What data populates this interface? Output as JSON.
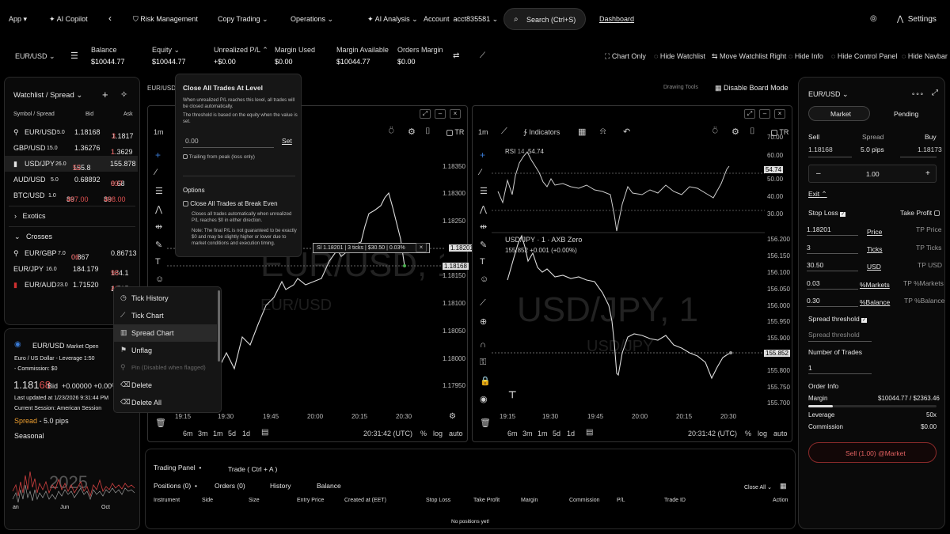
{
  "topnav": {
    "app": "App",
    "ai_copilot": "AI Copilot",
    "back": "‹",
    "risk_management": "Risk Management",
    "copy_trading": "Copy Trading",
    "operations": "Operations",
    "ai_analysis": "AI Analysis",
    "account_label": "Account",
    "account_id": "acct835581",
    "search": "Search (Ctrl+S)",
    "dashboard": "Dashboard",
    "settings": "Settings"
  },
  "account_bar": {
    "symbol": "EUR/USD",
    "balance_label": "Balance",
    "balance": "$10044.77",
    "equity_label": "Equity",
    "equity": "$10044.77",
    "upl_label": "Unrealized P/L",
    "upl": "+$0.00",
    "margin_used_label": "Margin Used",
    "margin_used": "$0.00",
    "margin_available_label": "Margin Available",
    "margin_available": "$10044.77",
    "orders_margin_label": "Orders Margin",
    "orders_margin": "$0.00",
    "chart_only": "Chart Only",
    "hide_watchlist": "Hide Watchlist",
    "move_watchlist": "Move Watchlist Right",
    "hide_info": "Hide Info",
    "hide_control_panel": "Hide Control Panel",
    "hide_navbar": "Hide Navbar"
  },
  "watchlist": {
    "title": "Watchlist / Spread",
    "col_symbol": "Symbol / Spread",
    "col_bid": "Bid",
    "col_ask": "Ask",
    "rows": [
      {
        "sym": "EUR/USD",
        "spread": "5.0",
        "bid": "1.18168",
        "ask_a": "1.1817",
        "ask_b": "3"
      },
      {
        "sym": "GBP/USD",
        "spread": "15.0",
        "bid": "1.36276",
        "ask_a": "1.3629",
        "ask_b": "1"
      },
      {
        "sym": "USD/JPY",
        "spread": "26.0",
        "bid_a": "155.8",
        "bid_b": "52",
        "ask": "155.878"
      },
      {
        "sym": "AUD/USD",
        "spread": "5.0",
        "bid": "0.68892",
        "ask_a": "0.68",
        "ask_b": "897"
      },
      {
        "sym": "BTC/USD",
        "spread": "1.0",
        "bid_a": "89",
        "bid_b": "467.00",
        "ask_a": "89",
        "ask_b": "468.00"
      }
    ],
    "exotics": "Exotics",
    "crosses": "Crosses",
    "cross_rows": [
      {
        "sym": "EUR/GBP",
        "spread": "7.0",
        "bid_a": "0.867",
        "bid_b": "06",
        "ask": "0.86713"
      },
      {
        "sym": "EUR/JPY",
        "spread": "16.0",
        "bid": "184.179",
        "ask_a": "184.1",
        "ask_b": "95"
      },
      {
        "sym": "EUR/AUD",
        "spread": "23.0",
        "bid": "1.71520",
        "ask_a": "1.715",
        "ask_b": "43"
      }
    ]
  },
  "info": {
    "symbol": "EUR/USD",
    "status": "Market Open",
    "desc": "Euro / US Dollar - Leverage 1:50",
    "commission": "- Commission: $0",
    "price_a": "1.181",
    "price_b": "68",
    "bid_label": "Bid",
    "change": "+0.00000 +0.00%",
    "updated": "Last updated at 1/23/2026 9:31:44 PM",
    "session": "Current Session: American Session",
    "spread_label": "Spread",
    "spread": "- 5.0 pips",
    "seasonal": "Seasonal",
    "seasonal_year": "2025",
    "months": [
      "an",
      "Jun",
      "Oct"
    ]
  },
  "board": {
    "symbol": "EUR/USD",
    "drawing_tools": "Drawing Tools",
    "disable_board": "Disable Board Mode"
  },
  "chart_left": {
    "interval": "1m",
    "tr": "TR",
    "watermark": "EUR/USD, 1",
    "watermark2": "EUR/USD",
    "y_ticks": [
      "1.18350",
      "1.18300",
      "1.18250",
      "1.18200",
      "1.18150",
      "1.18100",
      "1.18050",
      "1.18000",
      "1.17950"
    ],
    "price_tag": "1.18201",
    "price_tag2": "1.18168",
    "sl_label": "Sl 1.18201 | 3 ticks | $30.50 | 0.03%",
    "x_ticks": [
      "19:15",
      "19:30",
      "19:45",
      "20:00",
      "20:15",
      "20:30"
    ],
    "ranges": [
      "6m",
      "3m",
      "1m",
      "5d",
      "1d"
    ],
    "time": "20:31:42 (UTC)",
    "pct": "%",
    "log": "log",
    "auto": "auto"
  },
  "chart_right": {
    "interval": "1m",
    "indicators": "Indicators",
    "tr": "TR",
    "rsi_label": "RSI",
    "rsi_period": "14",
    "rsi_value": "54.74",
    "rsi_ticks": [
      "70.00",
      "60.00",
      "50.00",
      "40.00",
      "30.00"
    ],
    "rsi_tag": "54.74",
    "title": "USD/JPY · 1 · AXB Zero",
    "ohlc": "155.852",
    "change": "+0.001 (+0.00%)",
    "watermark": "USD/JPY, 1",
    "watermark2": "USD/JPY",
    "y_ticks": [
      "156.200",
      "156.150",
      "156.100",
      "156.050",
      "156.000",
      "155.950",
      "155.900",
      "155.850",
      "155.800",
      "155.750",
      "155.700"
    ],
    "price_tag": "155.852",
    "x_ticks": [
      "19:15",
      "19:30",
      "19:45",
      "20:00",
      "20:15",
      "20:30"
    ],
    "ranges": [
      "6m",
      "3m",
      "1m",
      "5d",
      "1d"
    ],
    "time": "20:31:42 (UTC)",
    "pct": "%",
    "log": "log",
    "auto": "auto"
  },
  "popup": {
    "title": "Close All Trades At Level",
    "desc": "When unrealized P/L reaches this level, all trades will be closed automatically.",
    "desc2": "The threshold is based on the equity when the value is set.",
    "input_value": "0.00",
    "set": "Set",
    "trailing": "Trailing from peak (loss only)",
    "options": "Options",
    "breakeven": "Close All Trades at Break Even",
    "be_desc": "Closes all trades automatically when unrealized P/L reaches $0 in either direction.",
    "be_note": "Note: The final P/L is not guaranteed to be exactly $0 and may be slightly higher or lower due to market conditions and execution timing."
  },
  "context_menu": {
    "items": [
      "Tick History",
      "Tick Chart",
      "Spread Chart",
      "Unflag",
      "Pin (Disabled when flagged)",
      "Delete",
      "Delete All"
    ]
  },
  "order": {
    "symbol": "EUR/USD",
    "tab_market": "Market",
    "tab_pending": "Pending",
    "sell_label": "Sell",
    "spread_label": "Spread",
    "buy_label": "Buy",
    "sell": "1.18168",
    "spread": "5.0 pips",
    "buy": "1.18173",
    "qty": "1.00",
    "exit": "Exit",
    "stop_loss": "Stop Loss",
    "take_profit": "Take Profit",
    "price_label": "Price",
    "tp_price": "TP Price",
    "sl_price": "1.18201",
    "ticks_label": "Ticks",
    "tp_ticks": "TP Ticks",
    "sl_ticks": "3",
    "usd_label": "USD",
    "tp_usd": "TP USD",
    "sl_usd": "30.50",
    "markets_label": "%Markets",
    "tp_markets": "TP %Markets",
    "sl_markets": "0.03",
    "balance_label": "%Balance",
    "tp_balance": "TP %Balance",
    "sl_balance": "0.30",
    "spread_threshold": "Spread threshold",
    "spread_threshold_ph": "Spread threshold",
    "num_trades_label": "Number of Trades",
    "num_trades": "1",
    "order_info": "Order Info",
    "margin_label": "Margin",
    "margin": "$10044.77 / $2363.46",
    "leverage_label": "Leverage",
    "leverage": "50x",
    "commission_label": "Commission",
    "commission": "$0.00",
    "submit": "Sell (1.00) @Market",
    "margin_fill": 0.19
  },
  "trading_panel": {
    "title": "Trading Panel",
    "trade": "Trade ( Ctrl + A )",
    "tabs": [
      "Positions (0)",
      "Orders (0)",
      "History",
      "Balance"
    ],
    "close_all": "Close All",
    "headers": [
      "Instrument",
      "Side",
      "Size",
      "Entry Price",
      "Created at (EET)",
      "Stop Loss",
      "Take Profit",
      "Margin",
      "Commission",
      "P/L",
      "Trade ID",
      "Action"
    ],
    "empty": "No positions yet!"
  },
  "colors": {
    "accent_red": "#e05050",
    "panel_bg": "#0a0a0a",
    "border": "#2a2a2a"
  }
}
